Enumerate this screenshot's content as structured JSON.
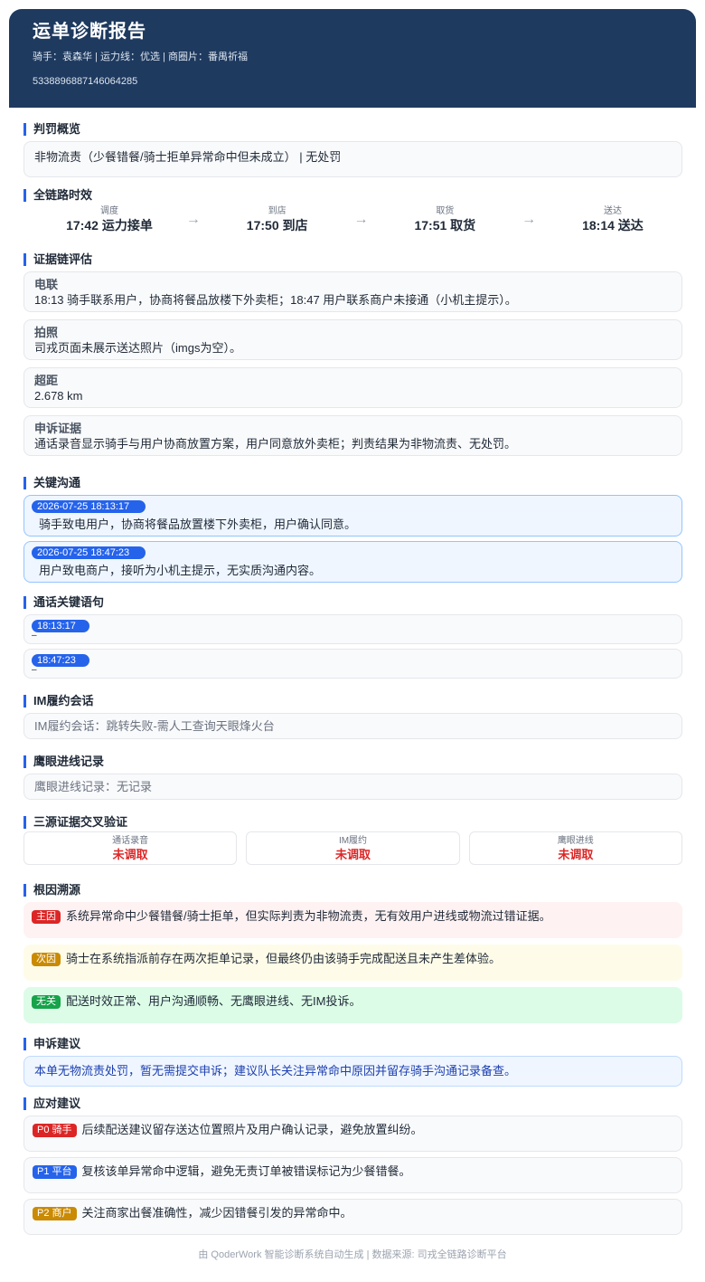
{
  "header": {
    "title": "运单诊断报告",
    "meta": "骑手：袁森华 | 运力线：优选 | 商圈片：番禺祈福",
    "order_id": "5338896887146064285"
  },
  "penalty": {
    "title": "判罚概览",
    "text": "非物流责（少餐错餐/骑士拒单异常命中但未成立） | 无处罚"
  },
  "timeline": {
    "title": "全链路时效",
    "steps": [
      {
        "label": "调度",
        "value": "17:42 运力接单"
      },
      {
        "label": "到店",
        "value": "17:50 到店"
      },
      {
        "label": "取货",
        "value": "17:51 取货"
      },
      {
        "label": "送达",
        "value": "18:14 送达"
      }
    ],
    "arrow": "→"
  },
  "evidence": {
    "title": "证据链评估",
    "items": [
      {
        "head": "电联",
        "body": "18:13 骑手联系用户，协商将餐品放楼下外卖柜；18:47 用户联系商户未接通（小机主提示）。"
      },
      {
        "head": "拍照",
        "body": "司戎页面未展示送达照片（imgs为空）。"
      },
      {
        "head": "超距",
        "body": "2.678 km"
      },
      {
        "head": "申诉证据",
        "body": "通话录音显示骑手与用户协商放置方案，用户同意放外卖柜；判责结果为非物流责、无处罚。"
      }
    ]
  },
  "communication": {
    "title": "关键沟通",
    "items": [
      {
        "time": "2026-07-25 18:13:17",
        "text": "骑手致电用户，协商将餐品放置楼下外卖柜，用户确认同意。"
      },
      {
        "time": "2026-07-25 18:47:23",
        "text": "用户致电商户，接听为小机主提示，无实质沟通内容。"
      }
    ]
  },
  "call_phrases": {
    "title": "通话关键语句",
    "items": [
      {
        "time": "18:13:17",
        "text": "–"
      },
      {
        "time": "18:47:23",
        "text": "–"
      }
    ]
  },
  "im": {
    "title": "IM履约会话",
    "text": "IM履约会话：跳转失败-需人工查询天眼烽火台"
  },
  "hawkeye": {
    "title": "鹰眼进线记录",
    "text": "鹰眼进线记录：无记录"
  },
  "cross_check": {
    "title": "三源证据交叉验证",
    "cells": [
      {
        "label": "通话录音",
        "value": "未调取"
      },
      {
        "label": "IM履约",
        "value": "未调取"
      },
      {
        "label": "鹰眼进线",
        "value": "未调取"
      }
    ]
  },
  "root_cause": {
    "title": "根因溯源",
    "items": [
      {
        "tag": "主因",
        "text": "系统异常命中少餐错餐/骑士拒单，但实际判责为非物流责，无有效用户进线或物流过错证据。",
        "color": "#dc2626"
      },
      {
        "tag": "次因",
        "text": "骑士在系统指派前存在两次拒单记录，但最终仍由该骑手完成配送且未产生差体验。",
        "color": "#ca8a04"
      },
      {
        "tag": "无关",
        "text": "配送时效正常、用户沟通顺畅、无鹰眼进线、无IM投诉。",
        "color": "#16a34a"
      }
    ]
  },
  "appeal": {
    "title": "申诉建议",
    "text": "本单无物流责处罚，暂无需提交申诉；建议队长关注异常命中原因并留存骑手沟通记录备查。"
  },
  "response": {
    "title": "应对建议",
    "items": [
      {
        "tag": "P0 骑手",
        "text": "后续配送建议留存送达位置照片及用户确认记录，避免放置纠纷。",
        "color": "#dc2626"
      },
      {
        "tag": "P1 平台",
        "text": "复核该单异常命中逻辑，避免无责订单被错误标记为少餐错餐。",
        "color": "#2563eb"
      },
      {
        "tag": "P2 商户",
        "text": "关注商家出餐准确性，减少因错餐引发的异常命中。",
        "color": "#ca8a04"
      }
    ]
  },
  "footer": "由 QoderWork 智能诊断系统自动生成 | 数据来源: 司戎全链路诊断平台"
}
